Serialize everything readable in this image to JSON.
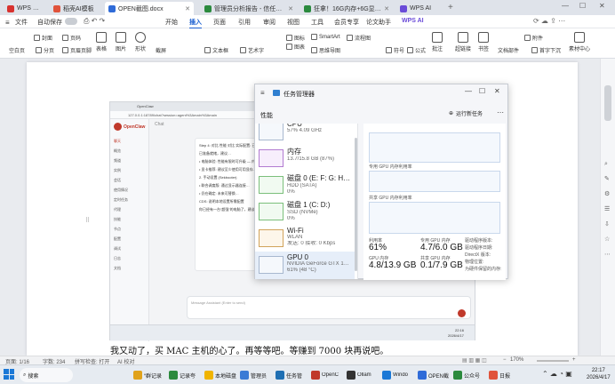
{
  "tabs": [
    {
      "label": "WPS Office",
      "color": "#d8322f"
    },
    {
      "label": "稻壳AI模板",
      "color": "#e0533b"
    },
    {
      "label": "OPEN截图.docx",
      "color": "#2f6bd8",
      "active": true
    },
    {
      "label": "管理员分析报告 - 信任工程风险分析",
      "color": "#2b8a3e"
    },
    {
      "label": "狂拿！16G内存+6G显卡，Win11...",
      "color": "#2b8a3e"
    },
    {
      "label": "WPS AI",
      "color": "#6a4bd8"
    }
  ],
  "menubar": {
    "file": "文件",
    "autosave": "自动保存",
    "items": [
      "开始",
      "插入",
      "页面",
      "引用",
      "审阅",
      "视图",
      "工具",
      "会员专享",
      "论文助手"
    ],
    "selected": "插入",
    "wps_ai": "WPS AI"
  },
  "ribbon": {
    "row1": [
      "封面",
      "页码",
      "表格",
      "图片",
      "形状",
      "图标",
      "SmartArt",
      "流程图",
      "附件"
    ],
    "row2": [
      "空白页",
      "分页",
      "页眉页脚",
      "截屏",
      "图表",
      "思维导图",
      "文本框",
      "艺术字",
      "符号",
      "公式",
      "批注",
      "超链接",
      "书签",
      "文档部件",
      "首字下沉",
      "素材中心"
    ]
  },
  "screenshot": {
    "app_name": "OpenClaw",
    "url": "127.0.0.1:18789/chat?session=agent%3Amain%3Amain",
    "breadcrumb": "Chat",
    "nav": [
      "聊天",
      "概览",
      "频道",
      "实例",
      "会话",
      "使用情况",
      "定时任务",
      "代理",
      "技能",
      "节点",
      "配置",
      "调试",
      "日志",
      "文档"
    ],
    "sections": [
      "控制",
      "代理",
      "设置",
      "资源"
    ],
    "messages": [
      "Step 4: 对比 性能 对比 实际配置: 已有 16GB",
      "已准备就绪，建议…",
      "• 电脑体验: 性能有限时可升级 — 内存…",
      "• 显卡推荐: 建议至少使用可用显存…",
      "2. 手动设置 (Sekbooter)",
      "• 联合调度版: 通过显示器连接…",
      "• 仍在确定: 未来可替换…",
      "CDS: 说明本地设置所需配置",
      "你已经有一台“超强”的电脑了，建议如下说明…"
    ],
    "input_placeholder": "Message Assistant (Enter to send)",
    "send_label": "发送",
    "time": "22:16",
    "date": "2026/4/17"
  },
  "task_manager": {
    "title": "任务管理器",
    "header": "性能",
    "run_task": "运行新任务",
    "items": [
      {
        "name": "CPU",
        "detail": "57%  4.09 GHz"
      },
      {
        "name": "内存",
        "detail": "13.7/15.8 GB (87%)"
      },
      {
        "name": "磁盘 0 (E: F: G: H: I:)",
        "detail": "HDD (SATA)",
        "detail2": "0%"
      },
      {
        "name": "磁盘 1 (C: D:)",
        "detail": "SSD (NVMe)",
        "detail2": "0%"
      },
      {
        "name": "Wi-Fi",
        "detail": "WLAN",
        "detail2": "发送: 0 接收: 0 Kbps"
      },
      {
        "name": "GPU 0",
        "detail": "NVIDIA GeForce GTX 1660",
        "detail2": "61% (48 °C)",
        "selected": true
      }
    ],
    "graph_labels": [
      "专用 GPU 内存利用率",
      "共享 GPU 内存利用率"
    ],
    "stats": [
      {
        "label": "利用率",
        "value": "61%"
      },
      {
        "label": "专用 GPU 内存",
        "value": "4.7/6.0 GB"
      },
      {
        "label": "GPU 内存",
        "value": "4.8/13.9 GB"
      },
      {
        "label": "共享 GPU 内存",
        "value": "0.1/7.9 GB"
      }
    ],
    "info": [
      "驱动程序版本:",
      "驱动程序日期:",
      "DirectX 版本:",
      "物理位置:",
      "为硬件保留的内存:"
    ]
  },
  "document": {
    "text": "我又动了，买 MAC 主机的心了。再等等吧。等赚到 7000 块再说吧。"
  },
  "status_bar": {
    "page": "页面: 1/16",
    "words": "字数: 234",
    "spell": "拼写检查: 打开",
    "ai": "AI 校对",
    "zoom": "170%"
  },
  "taskbar": {
    "search": "搜索",
    "apps": [
      "“群记录",
      "记录夸",
      "本地磁盘",
      "管理员",
      "任务管",
      "OpenC",
      "Ollam",
      "Windo",
      "OPEN截",
      "公众号",
      "日报"
    ],
    "time": "22:17",
    "date": "2026/4/17"
  },
  "colors": {
    "accent": "#1a5fd0",
    "wps_red": "#d8322f",
    "openclaw_red": "#c0392b"
  }
}
